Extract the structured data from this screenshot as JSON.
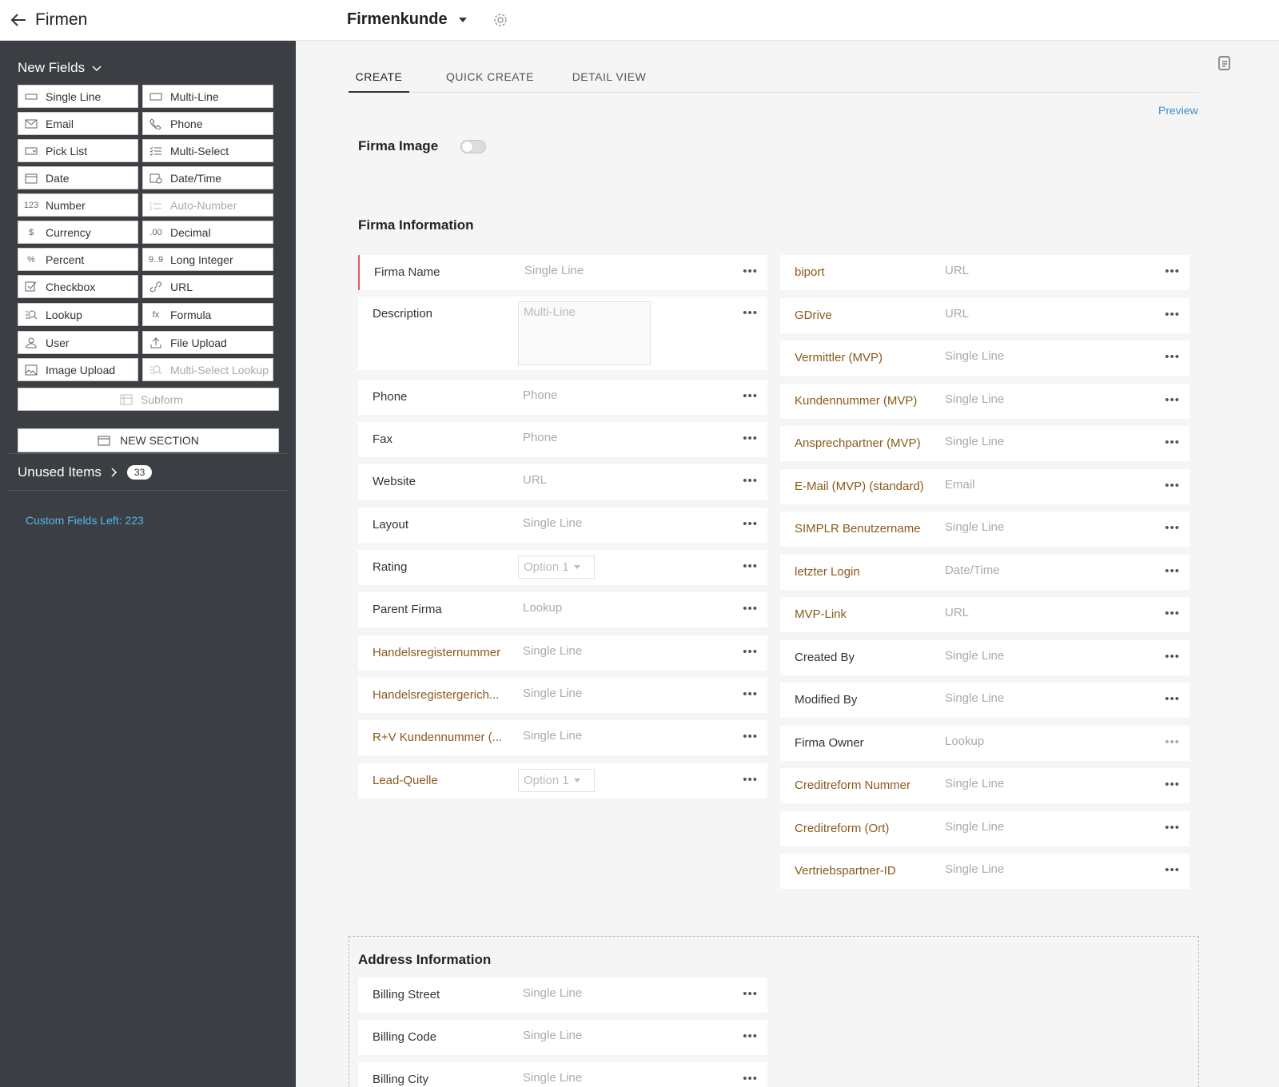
{
  "topbar": {
    "back_label": "Firmen",
    "layout_name": "Firmenkunde"
  },
  "sidebar": {
    "new_fields_label": "New Fields",
    "fields": [
      {
        "label": "Single Line",
        "icon": "single-line-icon",
        "disabled": false
      },
      {
        "label": "Multi-Line",
        "icon": "multi-line-icon",
        "disabled": false
      },
      {
        "label": "Email",
        "icon": "email-icon",
        "disabled": false
      },
      {
        "label": "Phone",
        "icon": "phone-icon",
        "disabled": false
      },
      {
        "label": "Pick List",
        "icon": "pick-list-icon",
        "disabled": false
      },
      {
        "label": "Multi-Select",
        "icon": "multi-select-icon",
        "disabled": false
      },
      {
        "label": "Date",
        "icon": "date-icon",
        "disabled": false
      },
      {
        "label": "Date/Time",
        "icon": "date-time-icon",
        "disabled": false
      },
      {
        "label": "Number",
        "icon": "number-icon",
        "glyph": "123",
        "disabled": false
      },
      {
        "label": "Auto-Number",
        "icon": "auto-number-icon",
        "disabled": true
      },
      {
        "label": "Currency",
        "icon": "currency-icon",
        "glyph": "$",
        "disabled": false
      },
      {
        "label": "Decimal",
        "icon": "decimal-icon",
        "glyph": ".00",
        "disabled": false
      },
      {
        "label": "Percent",
        "icon": "percent-icon",
        "glyph": "%",
        "disabled": false
      },
      {
        "label": "Long Integer",
        "icon": "long-integer-icon",
        "glyph": "9..9",
        "disabled": false
      },
      {
        "label": "Checkbox",
        "icon": "checkbox-icon",
        "disabled": false
      },
      {
        "label": "URL",
        "icon": "url-icon",
        "disabled": false
      },
      {
        "label": "Lookup",
        "icon": "lookup-icon",
        "disabled": false
      },
      {
        "label": "Formula",
        "icon": "formula-icon",
        "glyph": "fx",
        "disabled": false
      },
      {
        "label": "User",
        "icon": "user-icon",
        "disabled": false
      },
      {
        "label": "File Upload",
        "icon": "file-upload-icon",
        "disabled": false
      },
      {
        "label": "Image Upload",
        "icon": "image-upload-icon",
        "disabled": false
      },
      {
        "label": "Multi-Select Lookup",
        "icon": "multi-select-lookup-icon",
        "disabled": true
      }
    ],
    "subform_label": "Subform",
    "new_section_label": "NEW SECTION",
    "unused_items_label": "Unused Items",
    "unused_items_count": "33",
    "custom_fields_left": "Custom Fields Left: 223"
  },
  "main": {
    "tabs": [
      {
        "label": "CREATE",
        "active": true
      },
      {
        "label": "QUICK CREATE",
        "active": false
      },
      {
        "label": "DETAIL VIEW",
        "active": false
      }
    ],
    "preview_label": "Preview",
    "firma_image_label": "Firma Image",
    "firma_image_enabled": false,
    "sections": {
      "firma_info": {
        "title": "Firma Information",
        "left": [
          {
            "label": "Firma Name",
            "type": "Single Line",
            "required": true,
            "custom": false
          },
          {
            "label": "Description",
            "type": "Multi-Line",
            "custom": false,
            "kind": "multiline"
          },
          {
            "label": "Phone",
            "type": "Phone",
            "custom": false
          },
          {
            "label": "Fax",
            "type": "Phone",
            "custom": false
          },
          {
            "label": "Website",
            "type": "URL",
            "custom": false
          },
          {
            "label": "Layout",
            "type": "Single Line",
            "custom": false
          },
          {
            "label": "Rating",
            "type": "Option 1",
            "custom": false,
            "kind": "picklist"
          },
          {
            "label": "Parent Firma",
            "type": "Lookup",
            "custom": false
          },
          {
            "label": "Handelsregisternummer",
            "type": "Single Line",
            "custom": true
          },
          {
            "label": "Handelsregistergerich...",
            "type": "Single Line",
            "custom": true
          },
          {
            "label": "R+V Kundennummer (...",
            "type": "Single Line",
            "custom": true
          },
          {
            "label": "Lead-Quelle",
            "type": "Option 1",
            "custom": true,
            "kind": "picklist"
          }
        ],
        "right": [
          {
            "label": "biport",
            "type": "URL",
            "custom": true
          },
          {
            "label": "GDrive",
            "type": "URL",
            "custom": true
          },
          {
            "label": "Vermittler (MVP)",
            "type": "Single Line",
            "custom": true
          },
          {
            "label": "Kundennummer (MVP)",
            "type": "Single Line",
            "custom": true
          },
          {
            "label": "Ansprechpartner (MVP)",
            "type": "Single Line",
            "custom": true
          },
          {
            "label": "E-Mail (MVP) (standard)",
            "type": "Email",
            "custom": true
          },
          {
            "label": "SIMPLR Benutzername",
            "type": "Single Line",
            "custom": true
          },
          {
            "label": "letzter Login",
            "type": "Date/Time",
            "custom": true
          },
          {
            "label": "MVP-Link",
            "type": "URL",
            "custom": true
          },
          {
            "label": "Created By",
            "type": "Single Line",
            "custom": false
          },
          {
            "label": "Modified By",
            "type": "Single Line",
            "custom": false
          },
          {
            "label": "Firma Owner",
            "type": "Lookup",
            "custom": false,
            "faint_menu": true
          },
          {
            "label": "Creditreform Nummer",
            "type": "Single Line",
            "custom": true
          },
          {
            "label": "Creditreform (Ort)",
            "type": "Single Line",
            "custom": true
          },
          {
            "label": "Vertriebspartner-ID",
            "type": "Single Line",
            "custom": true
          }
        ]
      },
      "address_info": {
        "title": "Address Information",
        "left": [
          {
            "label": "Billing Street",
            "type": "Single Line",
            "custom": false
          },
          {
            "label": "Billing Code",
            "type": "Single Line",
            "custom": false
          },
          {
            "label": "Billing City",
            "type": "Single Line",
            "custom": false
          }
        ]
      }
    },
    "menu_glyph": "•••"
  },
  "colors": {
    "sidebar_bg": "#3b3f43",
    "custom_label": "#8a5a1a",
    "link": "#3c8fd1",
    "custom_fields_left": "#59b7ea",
    "required_marker": "#e25b5b"
  }
}
